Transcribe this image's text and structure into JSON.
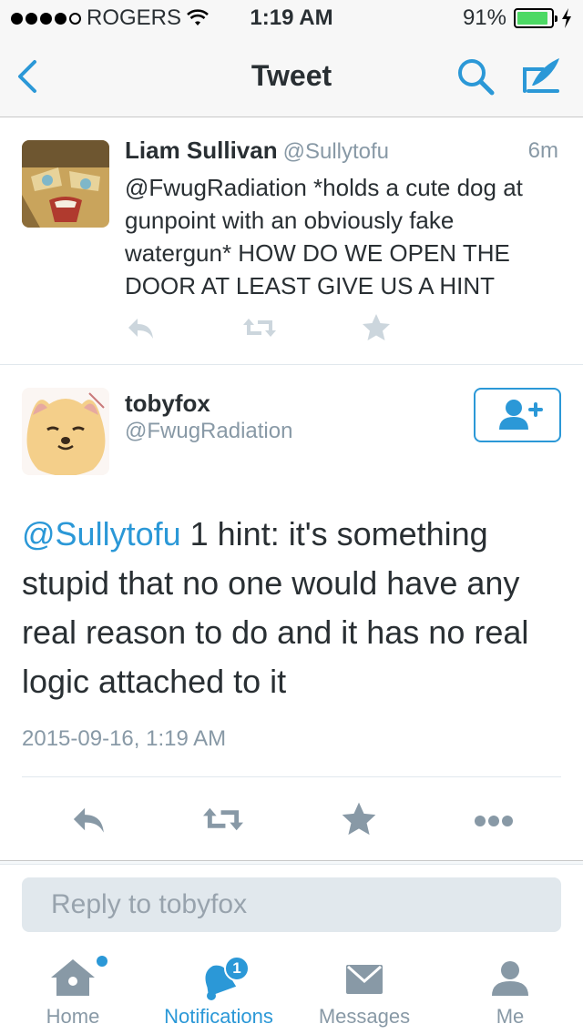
{
  "status_bar": {
    "carrier": "ROGERS",
    "time": "1:19 AM",
    "battery": "91%",
    "battery_level": 0.91,
    "signal_dots_filled": 4,
    "signal_dots_total": 5
  },
  "nav": {
    "title": "Tweet",
    "back_icon": "chevron-left-icon",
    "search_icon": "search-icon",
    "compose_icon": "compose-quill-icon"
  },
  "parent_tweet": {
    "name": "Liam Sullivan",
    "handle": "@Sullytofu",
    "time": "6m",
    "text": "@FwugRadiation *holds a cute dog at gunpoint with an obviously fake watergun* HOW DO WE OPEN THE DOOR AT LEAST GIVE US A HINT"
  },
  "main_tweet": {
    "name": "tobyfox",
    "handle": "@FwugRadiation",
    "mention": "@Sullytofu",
    "text": " 1 hint: it's something stupid that no one would have any real reason to do and it has no real logic attached to it",
    "date": "2015-09-16, 1:19 AM",
    "follow_icon": "follow-user-icon"
  },
  "reply": {
    "placeholder": "Reply to tobyfox"
  },
  "tabs": [
    {
      "label": "Home",
      "icon": "home-icon",
      "active": false,
      "new_indicator": true
    },
    {
      "label": "Notifications",
      "icon": "bell-icon",
      "active": true,
      "badge": "1"
    },
    {
      "label": "Messages",
      "icon": "envelope-icon",
      "active": false
    },
    {
      "label": "Me",
      "icon": "person-icon",
      "active": false
    }
  ],
  "colors": {
    "accent": "#2b98d7",
    "icon_gray": "#8899a6",
    "text": "#292f33"
  }
}
